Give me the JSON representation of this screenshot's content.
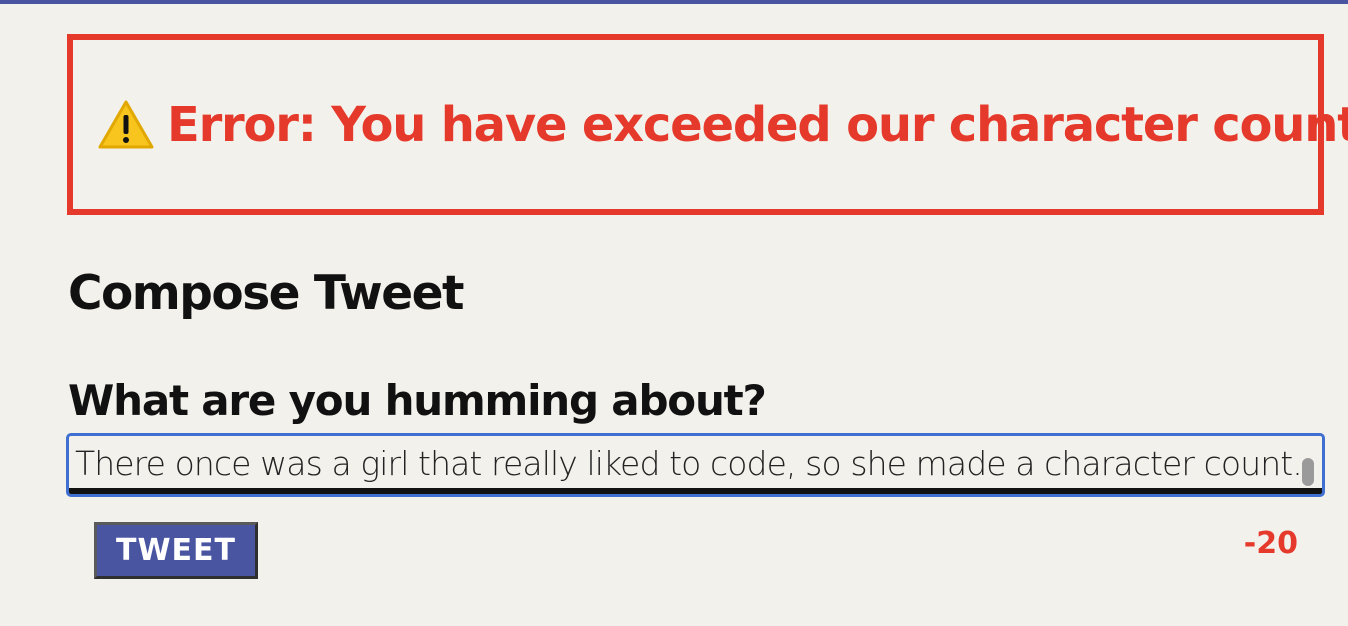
{
  "colors": {
    "accent": "#4a55a2",
    "error": "#e53a2b",
    "background": "#f3f1ec",
    "focus_border": "#3f6fd0"
  },
  "error_banner": {
    "icon": "warning-icon",
    "message": "Error: You have exceeded our character count."
  },
  "compose": {
    "title": "Compose Tweet",
    "prompt_label": "What are you humming about?",
    "tweet_text": "There once was a girl that really liked to code, so she made a character count.",
    "button_label": "TWEET",
    "character_count": "-20"
  }
}
